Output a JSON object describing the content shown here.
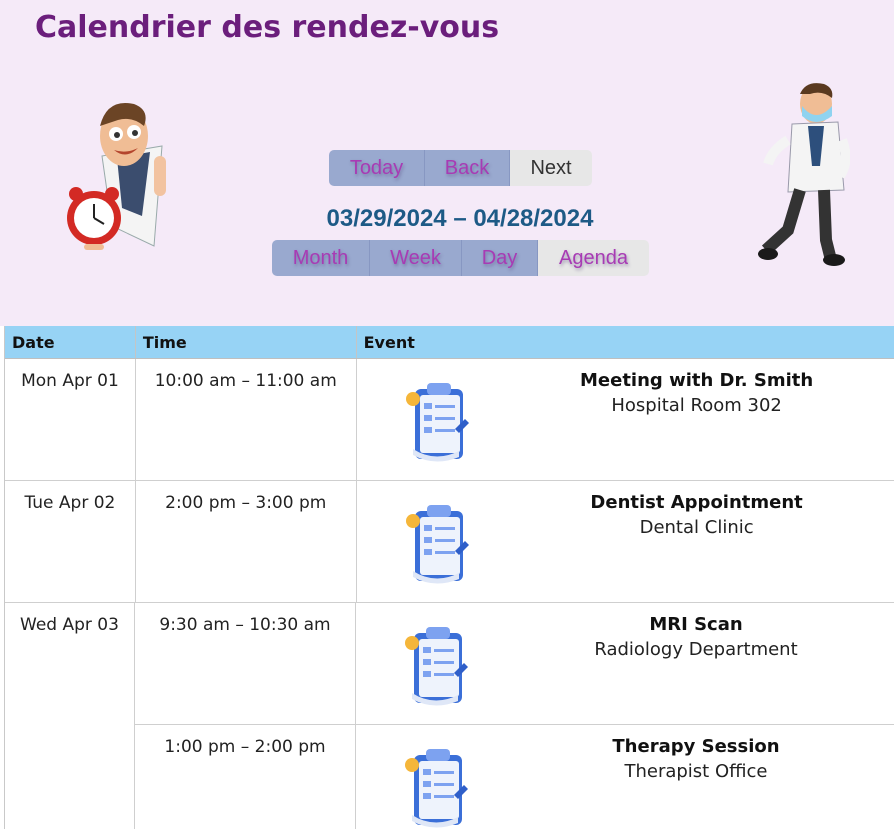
{
  "header": {
    "title": "Calendrier des rendez-vous",
    "range": "03/29/2024 – 04/28/2024",
    "nav_buttons": [
      "Today",
      "Back",
      "Next"
    ],
    "view_buttons": [
      "Month",
      "Week",
      "Day",
      "Agenda"
    ],
    "active_view": "Agenda"
  },
  "columns": {
    "date": "Date",
    "time": "Time",
    "event": "Event"
  },
  "events": [
    {
      "date": "Mon Apr 01",
      "time": "10:00 am – 11:00 am",
      "title": "Meeting with Dr. Smith",
      "location": "Hospital Room 302"
    },
    {
      "date": "Tue Apr 02",
      "time": "2:00 pm – 3:00 pm",
      "title": "Dentist Appointment",
      "location": "Dental Clinic"
    },
    {
      "date": "Wed Apr 03",
      "time": "9:30 am – 10:30 am",
      "title": "MRI Scan",
      "location": "Radiology Department"
    },
    {
      "date": "",
      "time": "1:00 pm – 2:00 pm",
      "title": "Therapy Session",
      "location": "Therapist Office"
    }
  ],
  "icons": {
    "left_illustration": "doctor-with-alarm-clock-icon",
    "right_illustration": "running-doctor-icon",
    "event_icon": "clipboard-checklist-icon"
  },
  "colors": {
    "header_bg": "#f5eaf8",
    "title": "#6b1e7c",
    "button_bg": "#99a9cf",
    "button_text": "#a83bb4",
    "range_text": "#1d5a86",
    "table_head_bg": "#97d3f5"
  }
}
